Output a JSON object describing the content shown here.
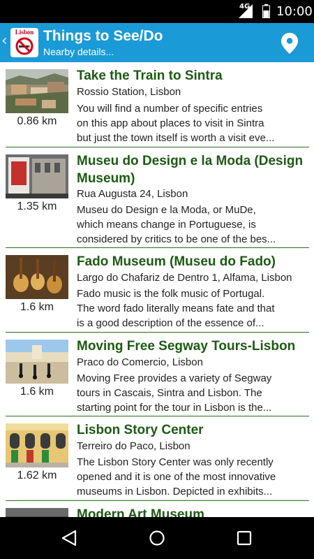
{
  "status": {
    "network": "4G",
    "time": "10:00"
  },
  "appbar": {
    "logo_text": "Lisbon",
    "title": "Things to See/Do",
    "subtitle": "Nearby details..."
  },
  "items": [
    {
      "name": "Take the Train to Sintra",
      "address": "Rossio Station, Lisbon",
      "desc_lines": [
        "You will find a number of specific entries",
        "on this app about places to visit in Sintra",
        "but just the town itself is worth a visit eve..."
      ],
      "distance": "0.86 km"
    },
    {
      "name_lines": [
        "Museu do Design e la Moda (Design",
        "Museum)"
      ],
      "address": "Rua Augusta 24, Lisbon",
      "desc_lines": [
        "Museu do Design e la Moda, or MuDe,",
        "which means change in Portuguese, is",
        "considered by critics to be one of the bes..."
      ],
      "distance": "1.35 km"
    },
    {
      "name": "Fado Museum (Museu do Fado)",
      "address": "Largo do Chafariz de Dentro 1, Alfama, Lisbon",
      "desc_lines": [
        "Fado music is the folk music of Portugal.",
        "The word fado literally means fate and that",
        "is a good description of the essence of..."
      ],
      "distance": "1.6 km"
    },
    {
      "name": "Moving Free Segway Tours-Lisbon",
      "address": "Praco do Comercio,  Lisbon",
      "desc_lines": [
        "Moving Free provides a variety of Segway",
        "tours in Cascais, Sintra and Lisbon.  The",
        "starting point for the tour in Lisbon is the..."
      ],
      "distance": "1.6 km"
    },
    {
      "name": "Lisbon Story Center",
      "address": "Terreiro do Paco, Lisbon",
      "desc_lines": [
        "The Lisbon Story Center was only recently",
        "opened and it is one of the most innovative",
        "museums in Lisbon.  Depicted in exhibits..."
      ],
      "distance": "1.62 km"
    },
    {
      "name": "Modern Art Museum"
    }
  ]
}
